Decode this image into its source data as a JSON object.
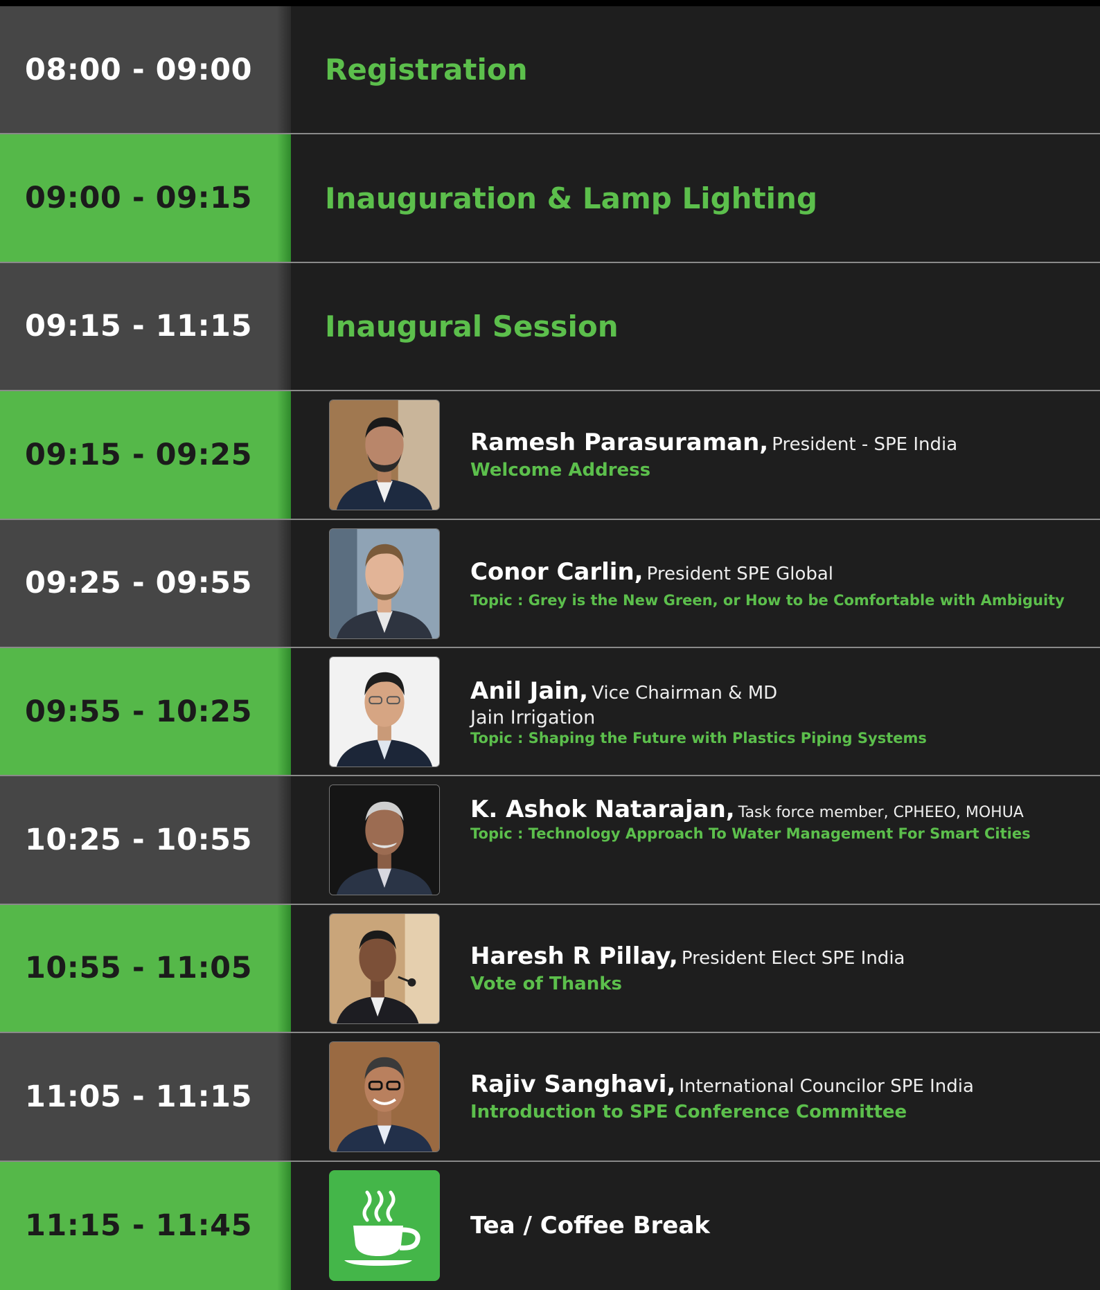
{
  "schedule": [
    {
      "time": "08:00 - 09:00",
      "title": "Registration"
    },
    {
      "time": "09:00 - 09:15",
      "title": "Inauguration & Lamp Lighting"
    },
    {
      "time": "09:15 - 11:15",
      "title": "Inaugural Session"
    },
    {
      "time": "09:15 - 09:25",
      "name": "Ramesh Parasuraman,",
      "role": "President - SPE India",
      "subtitle": "Welcome Address"
    },
    {
      "time": "09:25 - 09:55",
      "name": "Conor Carlin,",
      "role": "President SPE Global",
      "topic": "Topic : Grey is the New Green, or How to be Comfortable with Ambiguity"
    },
    {
      "time": "09:55 - 10:25",
      "name": "Anil Jain,",
      "role": "Vice Chairman & MD",
      "org": "Jain Irrigation",
      "topic": "Topic : Shaping the Future with Plastics Piping Systems"
    },
    {
      "time": "10:25 - 10:55",
      "name": "K. Ashok Natarajan,",
      "role": "Task force member, CPHEEO,  MOHUA",
      "topic": "Topic : Technology Approach To Water Management For Smart Cities"
    },
    {
      "time": "10:55 - 11:05",
      "name": "Haresh R Pillay,",
      "role": "President Elect SPE India",
      "subtitle": "Vote of Thanks"
    },
    {
      "time": "11:05 - 11:15",
      "name": "Rajiv Sanghavi,",
      "role": "International Councilor SPE India",
      "subtitle": "Introduction to SPE Conference Committee"
    },
    {
      "time": "11:15 - 11:45",
      "title": "Tea / Coffee Break",
      "icon": "coffee-cup-icon"
    }
  ],
  "colors": {
    "accent_green": "#5cbf4c",
    "time_green_bg": "#55b849",
    "time_dark_bg": "#464646",
    "row_bg": "#1e1e1e"
  }
}
